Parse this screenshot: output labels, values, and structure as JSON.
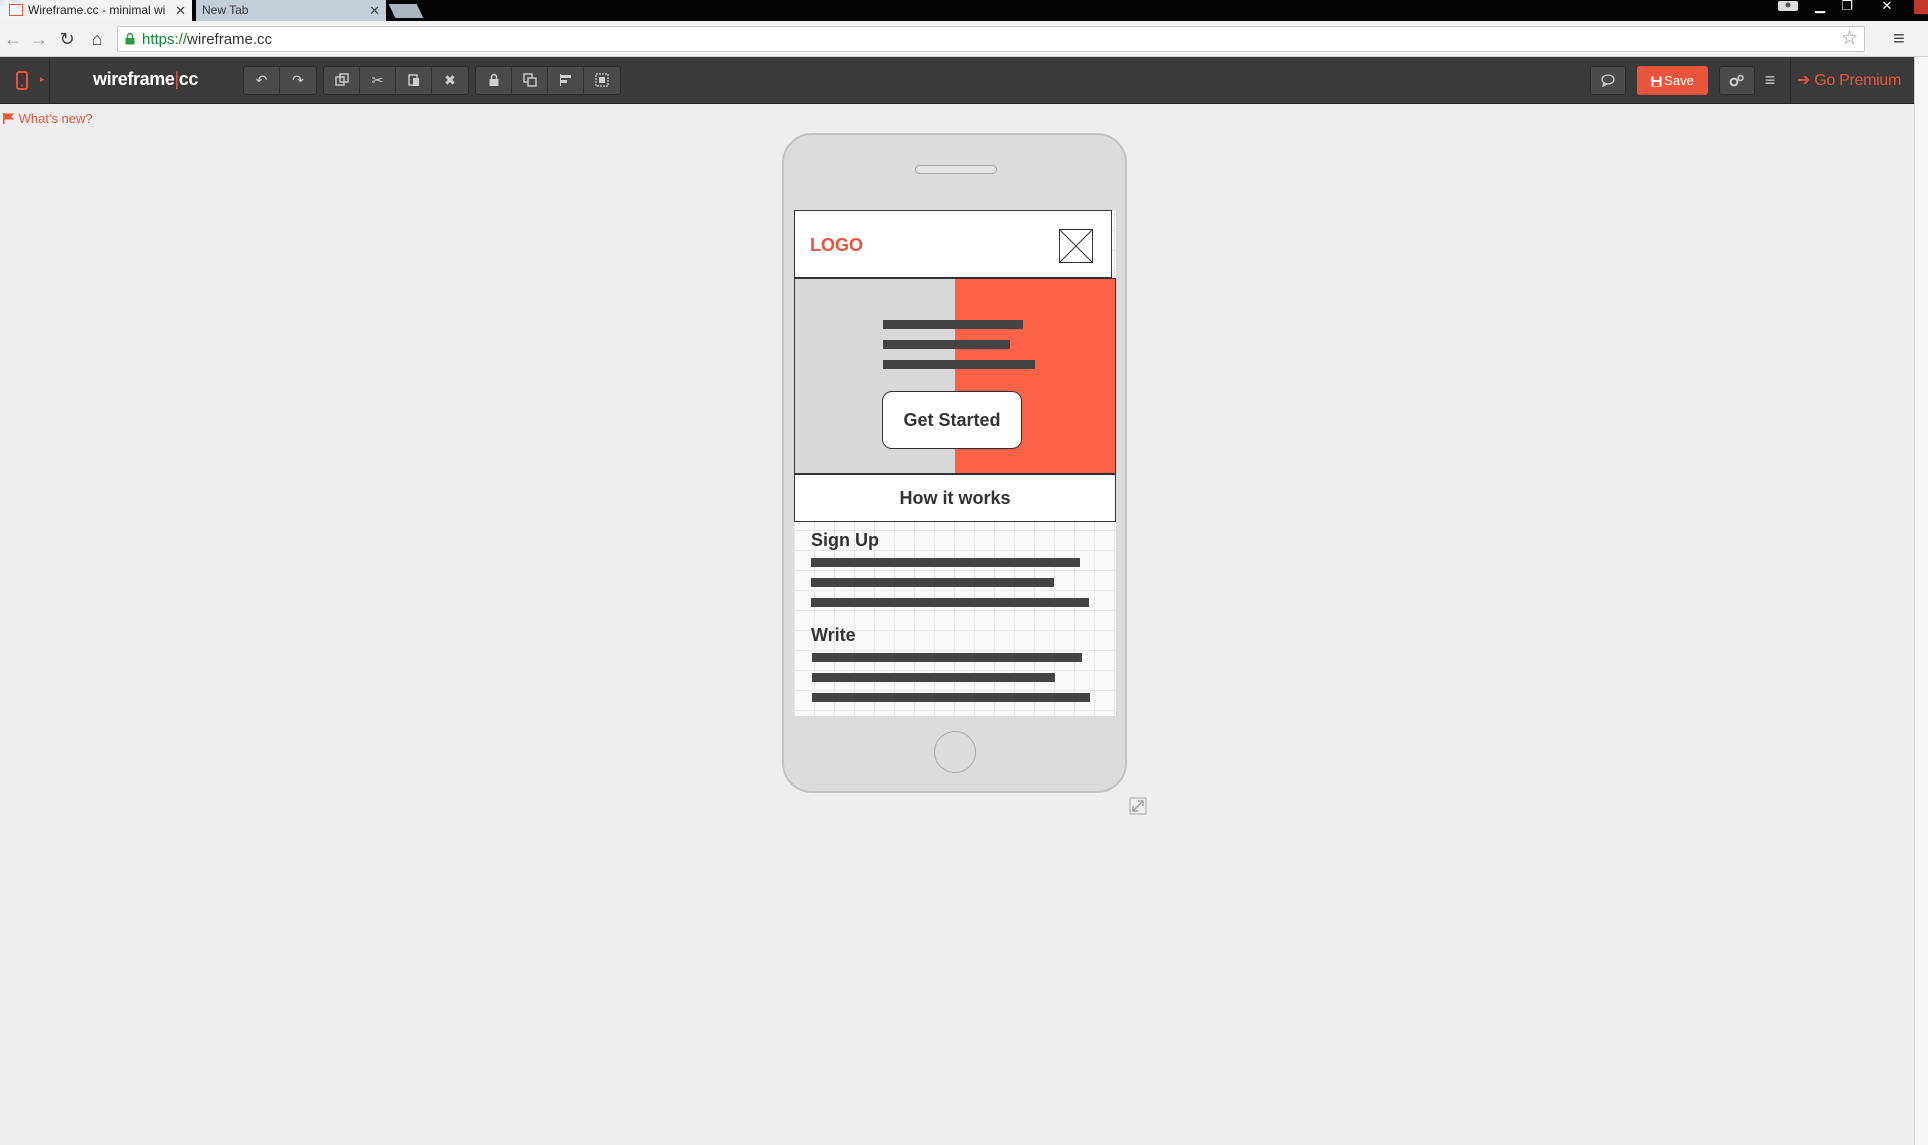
{
  "browser": {
    "tabs": [
      {
        "title": "Wireframe.cc - minimal wi",
        "active": true
      },
      {
        "title": "New Tab",
        "active": false
      }
    ],
    "url_scheme": "https://",
    "url_host": "wireframe.cc"
  },
  "toolbar": {
    "brand_main": "wireframe",
    "brand_sep": "|",
    "brand_suffix": "cc",
    "save_label": "Save",
    "premium_label": "Go Premium"
  },
  "canvas": {
    "whats_new": "What's new?"
  },
  "mockup": {
    "logo": "LOGO",
    "cta": "Get Started",
    "section_title": "How it works",
    "steps": [
      {
        "title": "Sign Up"
      },
      {
        "title": "Write"
      }
    ]
  },
  "colors": {
    "accent": "#e8553c",
    "hero_right": "#ff6347",
    "toolbar_bg": "#3a3a3a",
    "canvas_bg": "#eeeeee"
  }
}
